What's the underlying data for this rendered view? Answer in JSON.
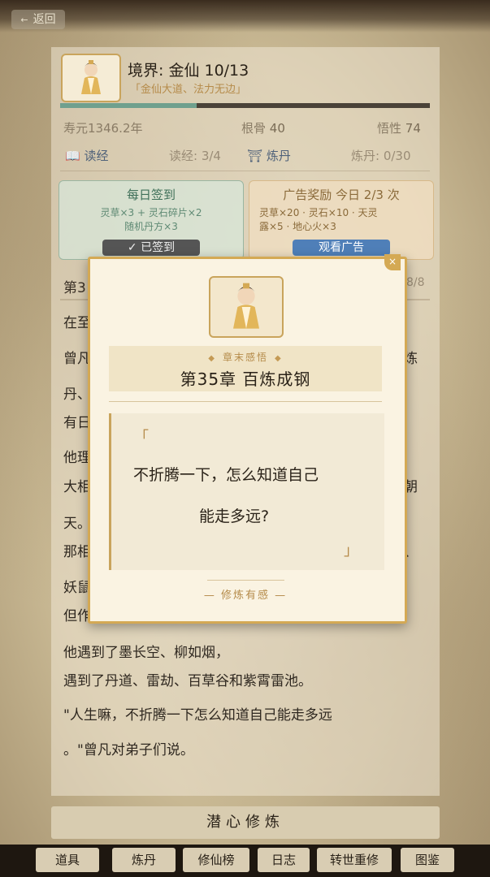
{
  "back_button": {
    "label": "返回"
  },
  "profile": {
    "realm_title": "境界: 金仙  10/13",
    "motto": "「金仙大道、法力无边」",
    "progress_fraction": 0.37,
    "lifespan": "寿元1346.2年",
    "root_label": "根骨",
    "root_value": "40",
    "insight_label": "悟性",
    "insight_value": "74"
  },
  "tasks": {
    "read_label": "读经",
    "read_count": "读经: 3/4",
    "alchemy_label": "炼丹",
    "alchemy_count": "炼丹: 0/30"
  },
  "rewards": {
    "daily": {
      "title": "每日签到",
      "desc1": "灵草×3 + 灵石碎片×2",
      "desc2": "随机丹方×3",
      "button": "✓ 已签到"
    },
    "ad": {
      "title": "广告奖励 今日 2/3 次",
      "desc1": "灵草×20 · 灵石×10 · 天灵",
      "desc2": "露×5 · 地心火×3",
      "button": "观看广告"
    }
  },
  "chapter": {
    "prefix": "第3",
    "progress": "8/8"
  },
  "story": {
    "l1": "在至",
    "l2": "曾凡",
    "l2_end": "炼",
    "l3": "丹、",
    "l4": "有日",
    "l5": "他理",
    "l6": "大相",
    "l6_end": "朝",
    "l7": "天。",
    "l8": "那相",
    "l8_end": "、",
    "l9": "妖鼠",
    "l10": "但作",
    "l11": "他遇到了墨长空、柳如烟，",
    "l12": "遇到了丹道、雷劫、百草谷和紫霄雷池。",
    "l13": "\"人生嘛，不折腾一下怎么知道自己能走多远",
    "l14": "。\"曾凡对弟子们说。"
  },
  "main_button": "潜心修炼",
  "nav": [
    "道具",
    "炼丹",
    "修仙榜",
    "日志",
    "转世重修",
    "图鉴"
  ],
  "modal": {
    "close_icon": "×",
    "subtitle": "章末感悟",
    "title": "第35章 百炼成钢",
    "quote_open": "「",
    "quote_line1": "不折腾一下，怎么知道自己",
    "quote_line2": "能走多远?",
    "quote_close": "」",
    "footer": "— 修炼有感 —"
  },
  "colors": {
    "accent_gold": "#d4a954",
    "progress_green": "#6fa08e",
    "ad_blue": "#4f7fb8"
  }
}
